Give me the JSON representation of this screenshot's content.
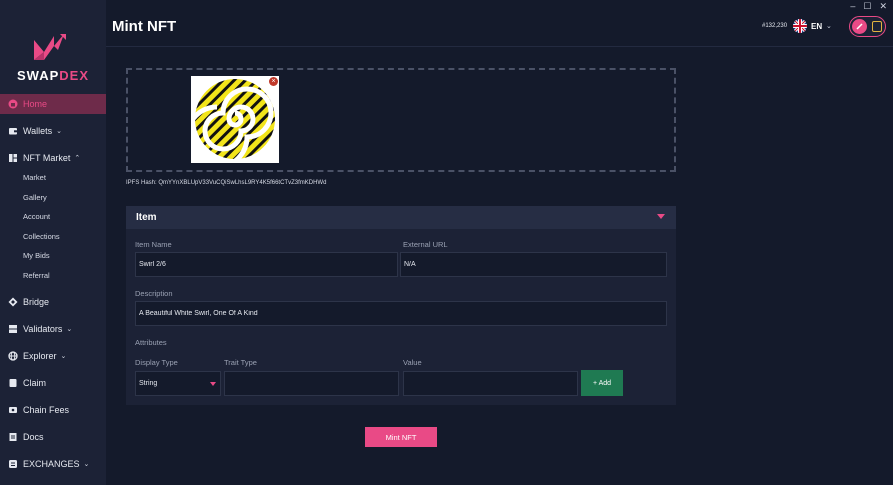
{
  "window": {
    "minimize": "–",
    "maximize": "☐",
    "close": "✕"
  },
  "brand": {
    "name_part1": "SWAP",
    "name_part2": "DEX",
    "accent": "#e94a86"
  },
  "sidebar": {
    "items": [
      {
        "label": "Home",
        "icon": "home-icon",
        "active": true
      },
      {
        "label": "Wallets",
        "icon": "wallet-icon",
        "caret": "⌄"
      },
      {
        "label": "NFT Market",
        "icon": "grid-icon",
        "caret": "⌃"
      },
      {
        "label": "Bridge",
        "icon": "bridge-icon"
      },
      {
        "label": "Validators",
        "icon": "server-icon",
        "caret": "⌄"
      },
      {
        "label": "Explorer",
        "icon": "globe-icon",
        "caret": "⌄"
      },
      {
        "label": "Claim",
        "icon": "claim-icon"
      },
      {
        "label": "Chain Fees",
        "icon": "fees-icon"
      },
      {
        "label": "Docs",
        "icon": "docs-icon"
      },
      {
        "label": "EXCHANGES",
        "icon": "exchange-icon",
        "caret": "⌄"
      }
    ],
    "nft_sub": [
      "Market",
      "Gallery",
      "Account",
      "Collections",
      "My Bids",
      "Referral"
    ]
  },
  "header": {
    "title": "Mint NFT",
    "balance": "#132,230",
    "language": "EN",
    "lang_caret": "⌄"
  },
  "dropzone": {
    "ipfs_hash": "IPFS Hash: QmYYnXBLUpV33VuCQiSwLhsL9RY4K5f66tCTvZ3fmKDHWd",
    "remove": "×"
  },
  "item": {
    "title": "Item",
    "item_name_label": "Item Name",
    "item_name_value": "Swirl 2/6",
    "external_url_label": "External URL",
    "external_url_value": "N/A",
    "description_label": "Description",
    "description_value": "A Beautiful White Swirl, One Of A Kind",
    "attributes_label": "Attributes",
    "display_type_label": "Display Type",
    "display_type_value": "String",
    "trait_type_label": "Trait Type",
    "trait_type_value": "",
    "value_label": "Value",
    "value_value": "",
    "add_label": "+ Add"
  },
  "mint_label": "Mint NFT"
}
